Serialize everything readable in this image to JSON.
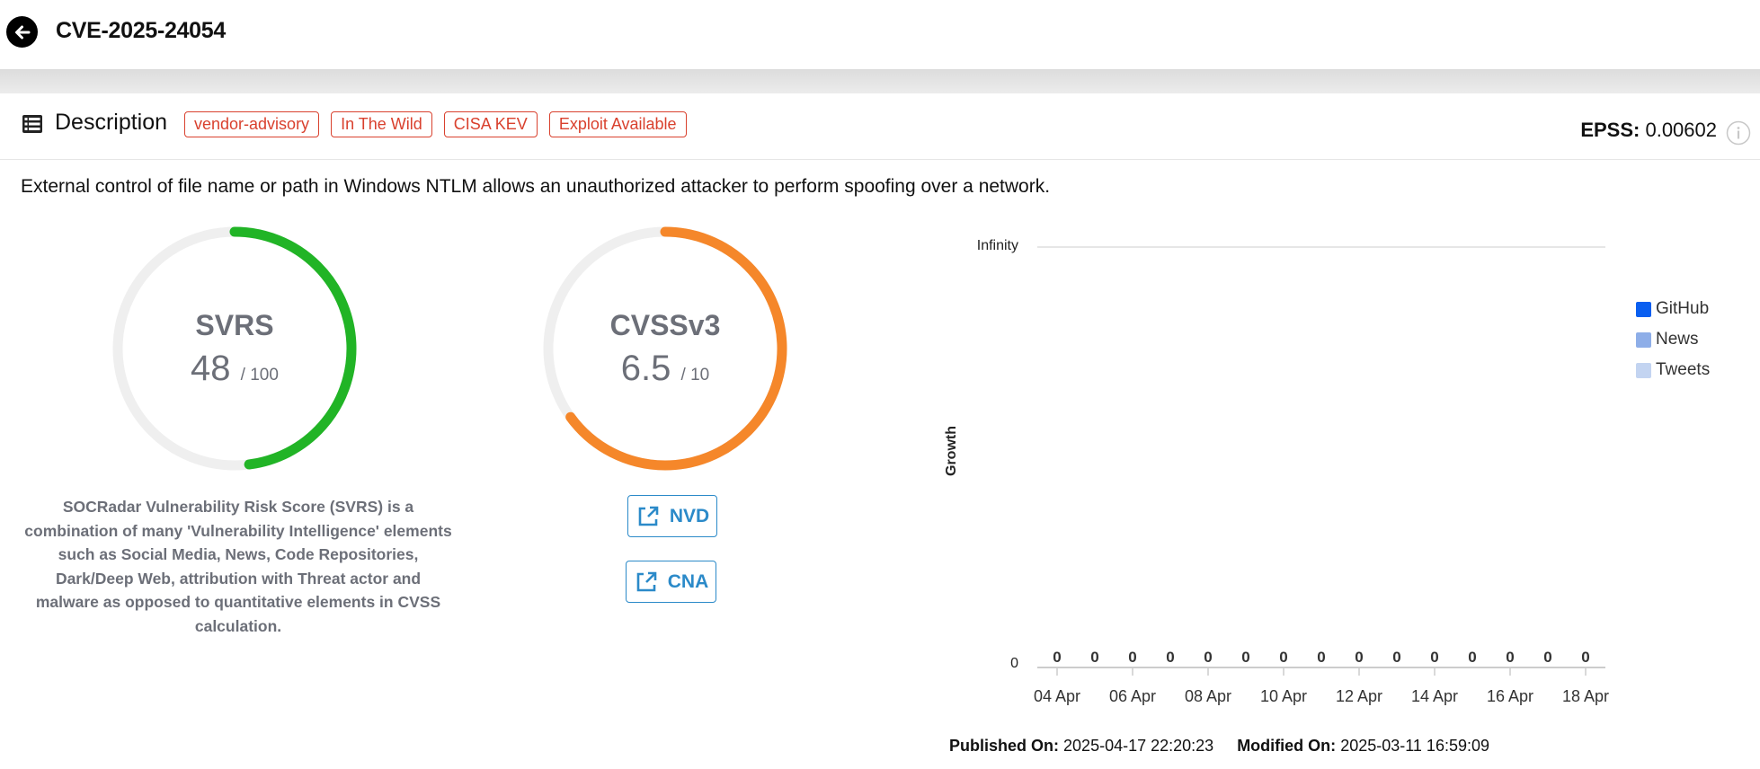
{
  "header": {
    "title": "CVE-2025-24054"
  },
  "description": {
    "section_title": "Description",
    "tags": [
      "vendor-advisory",
      "In The Wild",
      "CISA KEV",
      "Exploit Available"
    ],
    "epss_label": "EPSS:",
    "epss_value": "0.00602",
    "text": "External control of file name or path in Windows NTLM allows an unauthorized attacker to perform spoofing over a network."
  },
  "svrs": {
    "label": "SVRS",
    "score": "48",
    "max": "/ 100",
    "fraction": 0.48,
    "color": "#21b426",
    "note": "SOCRadar Vulnerability Risk Score (SVRS) is a combination of many 'Vulnerability Intelligence' elements such as Social Media, News, Code Repositories, Dark/Deep Web, attribution with Threat actor and malware as opposed to quantitative elements in CVSS calculation."
  },
  "cvss": {
    "label": "CVSSv3",
    "score": "6.5",
    "max": "/ 10",
    "fraction": 0.65,
    "color": "#f5872a"
  },
  "links": {
    "nvd": "NVD",
    "cna": "CNA"
  },
  "chart_data": {
    "type": "bar",
    "ylabel": "Growth",
    "ytick_labels": [
      "Infinity",
      "0"
    ],
    "x_tick_labels": [
      "04 Apr",
      "06 Apr",
      "08 Apr",
      "10 Apr",
      "12 Apr",
      "14 Apr",
      "16 Apr",
      "18 Apr"
    ],
    "data_labels": [
      "0",
      "0",
      "0",
      "0",
      "0",
      "0",
      "0",
      "0",
      "0",
      "0",
      "0",
      "0",
      "0",
      "0",
      "0"
    ],
    "series": [
      {
        "name": "GitHub",
        "color": "#0a5ff0",
        "values": [
          0,
          0,
          0,
          0,
          0,
          0,
          0,
          0,
          0,
          0,
          0,
          0,
          0,
          0,
          0
        ]
      },
      {
        "name": "News",
        "color": "#8eaee8",
        "values": [
          0,
          0,
          0,
          0,
          0,
          0,
          0,
          0,
          0,
          0,
          0,
          0,
          0,
          0,
          0
        ]
      },
      {
        "name": "Tweets",
        "color": "#c3d4f1",
        "values": [
          0,
          0,
          0,
          0,
          0,
          0,
          0,
          0,
          0,
          0,
          0,
          0,
          0,
          0,
          0
        ]
      }
    ],
    "legend": "right",
    "grid": true
  },
  "meta": {
    "published_label": "Published On:",
    "published_value": "2025-04-17 22:20:23",
    "modified_label": "Modified On:",
    "modified_value": "2025-03-11 16:59:09"
  }
}
